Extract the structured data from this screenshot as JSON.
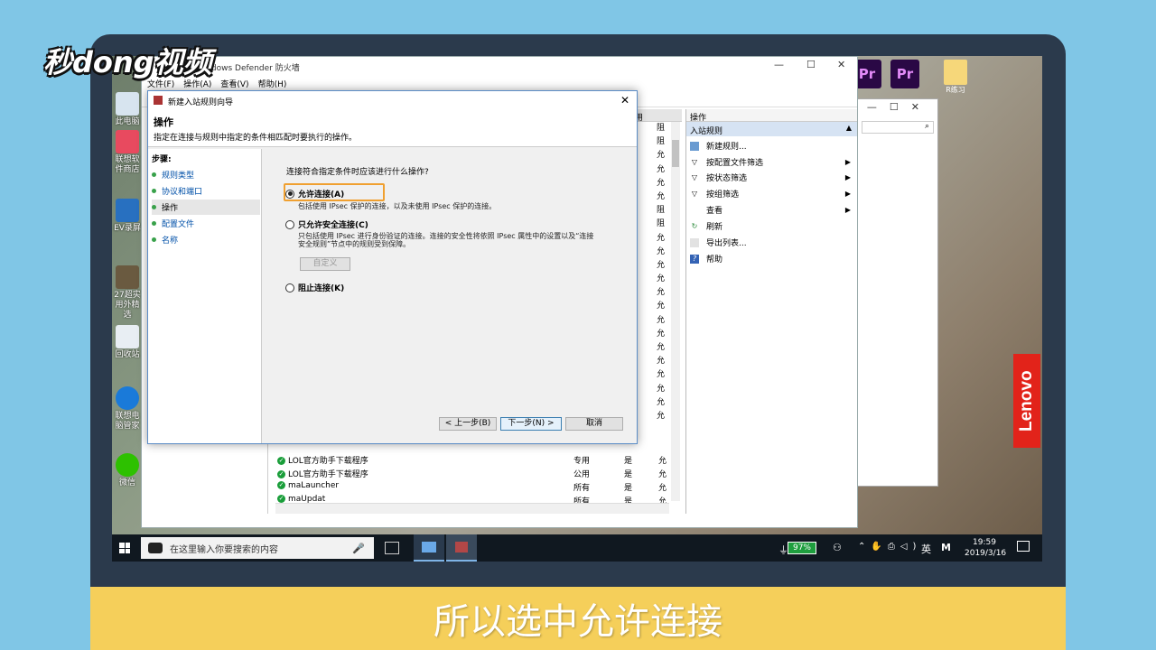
{
  "logo": {
    "text": "秒dong视频"
  },
  "caption": "所以选中允许连接",
  "desktop_icons": [
    {
      "label": "此电脑"
    },
    {
      "label": "联想软件商店"
    },
    {
      "label": "EV录屏"
    },
    {
      "label": "27超实用外精选"
    },
    {
      "label": "回收站"
    },
    {
      "label": "联想电脑管家"
    },
    {
      "label": "微信"
    }
  ],
  "top_apps": [
    {
      "label": "Pr"
    },
    {
      "label": "Pr"
    },
    {
      "label": "R练习"
    }
  ],
  "mainwin": {
    "title": "Windows Defender 防火墙",
    "menu": [
      "文件(F)",
      "操作(A)",
      "查看(V)",
      "帮助(H)"
    ],
    "rows": [
      {
        "name": "LOL官方助手下载程序",
        "profile": "专用",
        "enabled": "是",
        "action": "允"
      },
      {
        "name": "LOL官方助手下载程序",
        "profile": "公用",
        "enabled": "是",
        "action": "允"
      },
      {
        "name": "maLauncher",
        "profile": "所有",
        "enabled": "是",
        "action": "允"
      },
      {
        "name": "maUpdat",
        "profile": "所有",
        "enabled": "是",
        "action": "允"
      }
    ],
    "col_header_partial": "用",
    "action_column": [
      "阻",
      "阻",
      "允",
      "允",
      "允",
      "允",
      "阻",
      "阻",
      "允",
      "允",
      "允",
      "允",
      "允",
      "允",
      "允",
      "允",
      "允",
      "允",
      "允",
      "允",
      "允",
      "允"
    ]
  },
  "actions_pane": {
    "header": "操作",
    "section": "入站规则",
    "items": [
      {
        "label": "新建规则...",
        "icon": "new-rule-icon",
        "submenu": false
      },
      {
        "label": "按配置文件筛选",
        "icon": "filter-icon",
        "submenu": true
      },
      {
        "label": "按状态筛选",
        "icon": "filter-icon",
        "submenu": true
      },
      {
        "label": "按组筛选",
        "icon": "filter-icon",
        "submenu": true
      },
      {
        "label": "查看",
        "icon": "",
        "submenu": true
      },
      {
        "label": "刷新",
        "icon": "refresh-icon",
        "submenu": false
      },
      {
        "label": "导出列表...",
        "icon": "export-icon",
        "submenu": false
      },
      {
        "label": "帮助",
        "icon": "help-icon",
        "submenu": false
      }
    ]
  },
  "dialog": {
    "title": "新建入站规则向导",
    "heading": "操作",
    "subheading": "指定在连接与规则中指定的条件相匹配时要执行的操作。",
    "steps_title": "步骤:",
    "steps": [
      {
        "label": "规则类型",
        "current": false
      },
      {
        "label": "协议和端口",
        "current": false
      },
      {
        "label": "操作",
        "current": true
      },
      {
        "label": "配置文件",
        "current": false
      },
      {
        "label": "名称",
        "current": false
      }
    ],
    "question": "连接符合指定条件时应该进行什么操作?",
    "options": [
      {
        "label": "允许连接(A)",
        "desc": "包括使用 IPsec 保护的连接，以及未使用 IPsec 保护的连接。",
        "selected": true
      },
      {
        "label": "只允许安全连接(C)",
        "desc": "只包括使用 IPsec 进行身份验证的连接。连接的安全性将依照 IPsec 属性中的设置以及“连接安全规则”节点中的规则受到保障。",
        "selected": false
      },
      {
        "label": "阻止连接(K)",
        "desc": "",
        "selected": false
      }
    ],
    "customize_label": "自定义",
    "back_label": "< 上一步(B)",
    "next_label": "下一步(N) >",
    "cancel_label": "取消"
  },
  "taskbar": {
    "search_placeholder": "在这里输入你要搜索的内容",
    "battery": "97%",
    "ime": "英",
    "ime2": "M",
    "time": "19:59",
    "date": "2019/3/16"
  }
}
